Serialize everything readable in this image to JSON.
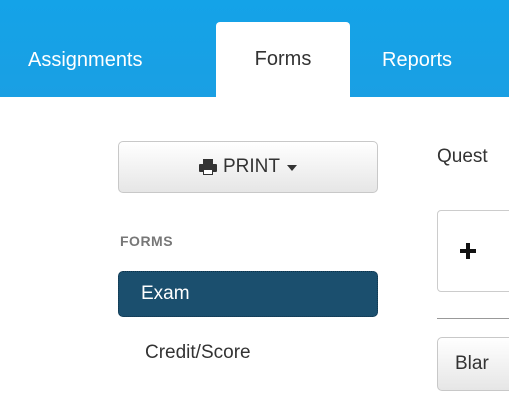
{
  "tabs": [
    {
      "label": "Assignments",
      "active": false
    },
    {
      "label": "Forms",
      "active": true
    },
    {
      "label": "Reports",
      "active": false
    }
  ],
  "sidebar": {
    "print_button": {
      "label": "PRINT",
      "icon": "printer-icon"
    },
    "section_header": "FORMS",
    "items": [
      {
        "label": "Exam",
        "selected": true
      },
      {
        "label": "Credit/Score",
        "selected": false
      }
    ]
  },
  "main": {
    "label_partial": "Quest",
    "add_button": {
      "icon": "plus-icon",
      "label_partial": ""
    },
    "blank_button": {
      "label_partial": "Blar"
    }
  },
  "colors": {
    "tab_bar": "#1a9fe3",
    "selected_item": "#1b4f6e",
    "text": "#333333"
  }
}
